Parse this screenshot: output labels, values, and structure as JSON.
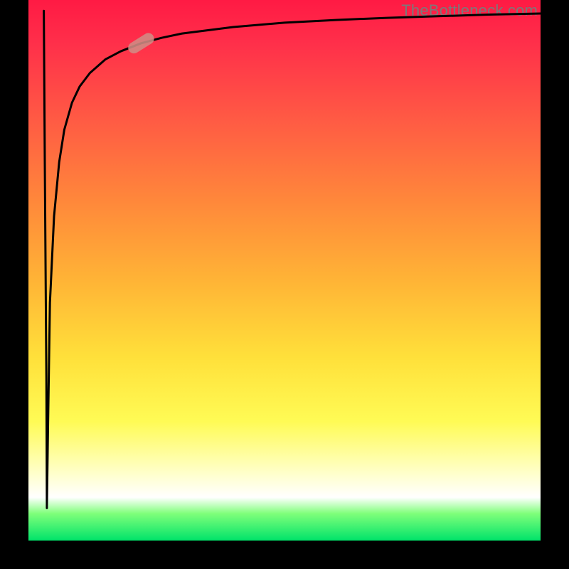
{
  "watermark": "TheBottleneck.com",
  "colors": {
    "frame": "#000000",
    "watermark_text": "#7a7a7a",
    "curve": "#000000",
    "marker": "#d08c84",
    "gradient_stops": [
      "#ff1a44",
      "#ff5a44",
      "#ff8a3a",
      "#ffe03a",
      "#ffffd0",
      "#ffffff",
      "#00e36a"
    ]
  },
  "chart_data": {
    "type": "line",
    "title": "",
    "xlabel": "",
    "ylabel": "",
    "xlim": [
      0,
      100
    ],
    "ylim": [
      0,
      100
    ],
    "grid": false,
    "series": [
      {
        "name": "curve",
        "x": [
          3.0,
          3.2,
          3.5,
          3.6,
          3.8,
          4.2,
          5.0,
          6.0,
          7.0,
          8.5,
          10,
          12,
          15,
          18,
          22,
          26,
          30,
          40,
          50,
          60,
          70,
          80,
          90,
          100
        ],
        "y": [
          98,
          70,
          30,
          6,
          20,
          44,
          60,
          70,
          76,
          81,
          84,
          86.5,
          89,
          90.5,
          92,
          93,
          93.8,
          95,
          95.8,
          96.3,
          96.7,
          97,
          97.3,
          97.5
        ]
      }
    ],
    "marker": {
      "x": 22,
      "y": 92,
      "angle_deg": -32
    },
    "notes": "Values read off a borderless gradient plot; x and y are percentages of plot width/height. At x≈3 curve drops from ~98 to ~6 then rises asymptotically toward ~97.5."
  }
}
